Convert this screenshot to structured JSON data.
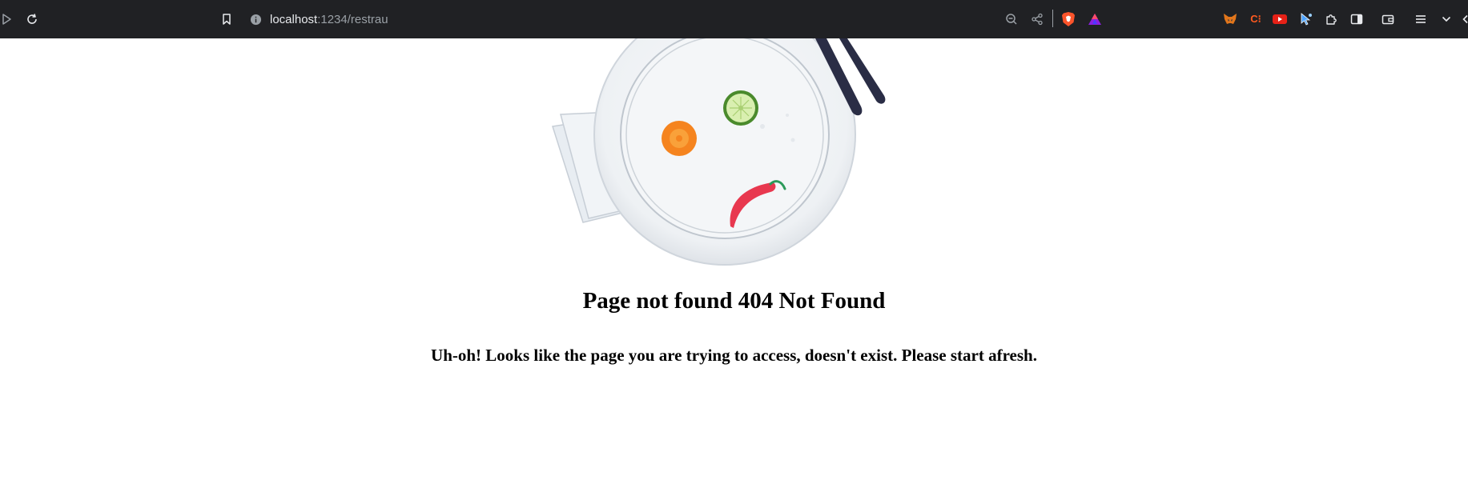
{
  "browser": {
    "url_host": "localhost",
    "url_path": ":1234/restrau",
    "icons": [
      "play-icon",
      "reload-icon",
      "bookmark-icon",
      "site-info-icon",
      "zoom-out-icon",
      "share-icon",
      "brave-shields-icon",
      "brave-rewards-icon",
      "metamask-icon",
      "extension-c-icon",
      "youtube-extension-icon",
      "cursor-extension-icon",
      "extensions-puzzle-icon",
      "sidebar-icon",
      "wallet-icon",
      "menu-icon",
      "chevron-down-icon"
    ],
    "extension_c_label": "C⁝"
  },
  "page": {
    "heading": "Page not found 404 Not Found",
    "message": "Uh-oh! Looks like the page you are trying to access, doesn't exist. Please start afresh."
  },
  "colors": {
    "toolbar_bg": "#202124",
    "carrot": "#f5841f",
    "cucumber": "#4a8a2c",
    "chili": "#e8384f",
    "cutlery": "#2a2d45",
    "plate": "#f5f7f9"
  }
}
